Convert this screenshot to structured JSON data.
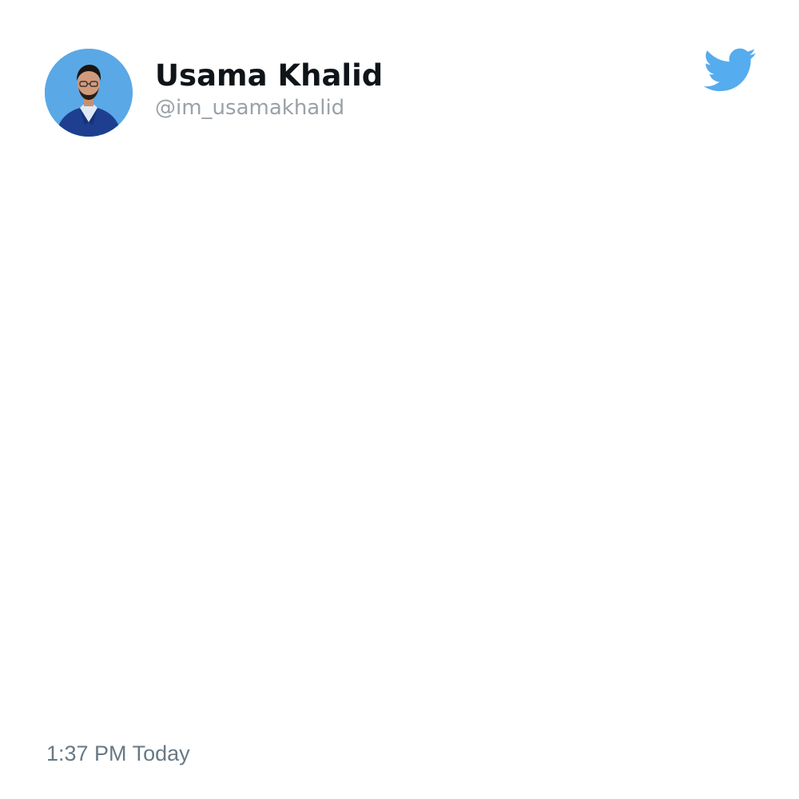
{
  "author": {
    "display_name": "Usama Khalid",
    "handle": "@im_usamakhalid",
    "avatar": "profile-photo"
  },
  "brand": {
    "icon": "twitter-bird-icon",
    "color": "#55acee"
  },
  "tweet": {
    "text": "",
    "timestamp": "1:37 PM Today"
  },
  "colors": {
    "name": "#0f1419",
    "handle": "#9aa1a8",
    "timestamp": "#687985",
    "avatar_background": "#5aa8e6"
  }
}
